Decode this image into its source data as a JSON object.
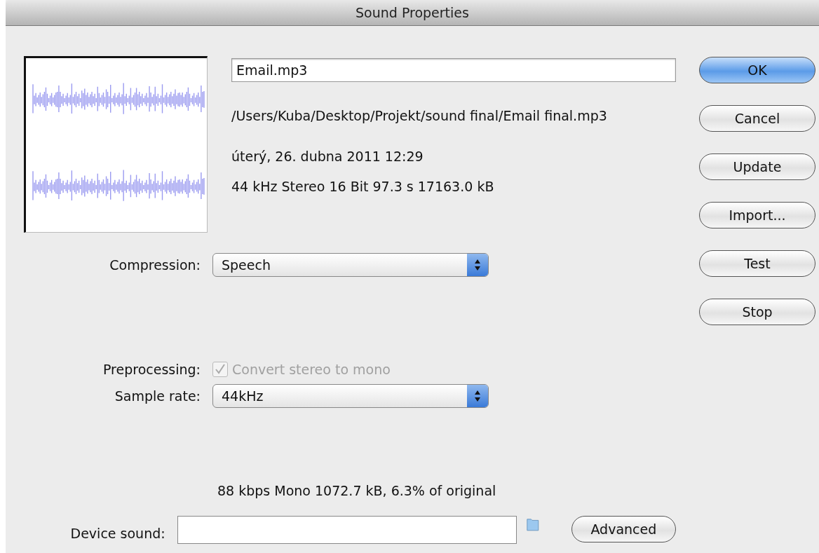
{
  "window": {
    "title": "Sound Properties"
  },
  "file_name": {
    "value": "Email.mp3"
  },
  "path": "/Users/Kuba/Desktop/Projekt/sound final/Email final.mp3",
  "date": "úterý, 26. dubna 2011  12:29",
  "info": "44 kHz Stereo 16 Bit 97.3 s 17163.0 kB",
  "compression": {
    "label": "Compression:",
    "value": "Speech"
  },
  "preprocessing": {
    "label": "Preprocessing:",
    "option": "Convert stereo to mono",
    "checked": true,
    "disabled": true
  },
  "sample_rate": {
    "label": "Sample rate:",
    "value": "44kHz"
  },
  "summary": "88 kbps  Mono 1072.7 kB, 6.3% of original",
  "device_sound": {
    "label": "Device sound:"
  },
  "buttons": [
    {
      "label": "OK",
      "default": true
    },
    {
      "label": "Cancel",
      "default": false
    },
    {
      "label": "Update",
      "default": false
    },
    {
      "label": "Import...",
      "default": false
    },
    {
      "label": "Test",
      "default": false
    },
    {
      "label": "Stop",
      "default": false
    }
  ],
  "advanced_button": {
    "label": "Advanced"
  }
}
